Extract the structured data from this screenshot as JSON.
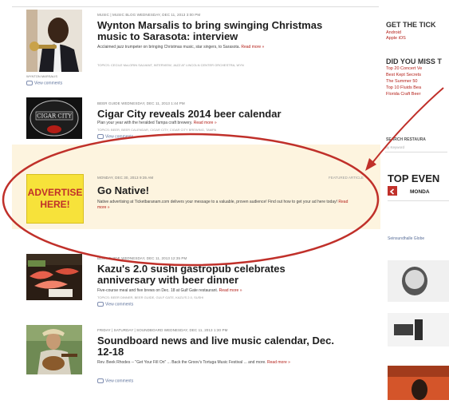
{
  "articles": [
    {
      "meta": "MUSIC | MUSIC BLOG  WEDNESDAY, DEC 11, 2013 3:00 PM",
      "headline": "Wynton Marsalis to bring swinging Christmas music to Sarasota: interview",
      "body": "Acclaimed jazz trumpeter on bringing Christmas music, star singers, to Sarasota.",
      "readmore": "Read more »",
      "tags": "TOPICS: CECILE McLORIN SALVANT, INTERVIEW, JAZZ AT LINCOLN CENTER ORCHESTRA, WYN",
      "caption": "WYNTON MARSALIS",
      "comments": "View comments"
    },
    {
      "meta": "BEER GUIDE  WEDNESDAY, DEC 11, 2013 1:44 PM",
      "headline": "Cigar City reveals 2014 beer calendar",
      "body": "Plan your year with the heralded Tampa craft brewery.",
      "readmore": "Read more »",
      "tags": "TOPICS: BEER, BEER CALENDAR, CIGAR CITY, CIGAR CITY BREWING, TAMPA",
      "comments": "View comments",
      "logo": "CIGAR CITY"
    },
    {
      "meta": "BEER GUIDE  WEDNESDAY, DEC 11, 2013 12:35 PM",
      "headline": "Kazu's 2.0 sushi gastropub celebrates anniversary with beer dinner",
      "body": "Five-course meal and five brews on Dec. 18 at Gulf Gate restaurant.",
      "readmore": "Read more »",
      "tags": "TOPICS: BEER DINNER, BEER GUIDE, GULF GATE, KAZU'S 2.0, SUSHI",
      "comments": "View comments"
    },
    {
      "meta": "FRIDAY | SATURDAY | SOUNDBOARD  WEDNESDAY, DEC 11, 2013 1:30 PM",
      "headline": "Soundboard news and live music calendar, Dec. 12-18",
      "body": "Rev. Beek Rhodes -- \"Get Your Fill On\" ... Back the Groov's Tortuga Music Festival ... and more.",
      "readmore": "Read more »",
      "comments": "View comments"
    }
  ],
  "promo": {
    "meta": "MONDAY, DEC 30, 2013 9:35 AM",
    "sponsored": "FEATURED ARTICLE",
    "ad_line1": "ADVERTISE",
    "ad_line2": "HERE!",
    "headline": "Go Native!",
    "body": "Native advertising at Ticketbaranam.com delivers your message to a valuable, proven audience! Find out how to get your ad here today!",
    "readmore": "Read more »"
  },
  "sidebar": {
    "tickets_head": "GET THE TICK",
    "tickets_links": [
      "Android",
      "Apple iOS"
    ],
    "miss_head": "DID YOU MISS T",
    "miss_links": [
      "Top 20 Concert Ve",
      "Best Kept Secrets",
      "The Summer 50",
      "Top 10 Fluids Bea",
      "Florida Craft Beer"
    ],
    "search_head": "SEARCH RESTAURA",
    "search_placeholder": "By Keyword",
    "events_head": "TOP EVEN",
    "day": "MONDA",
    "event_label": "Seinsundhalle Globe"
  },
  "colors": {
    "accent": "#b31d16",
    "promo_bg": "#fdf4df",
    "ad_yellow": "#f7e23a",
    "annotation": "#c0302a"
  }
}
